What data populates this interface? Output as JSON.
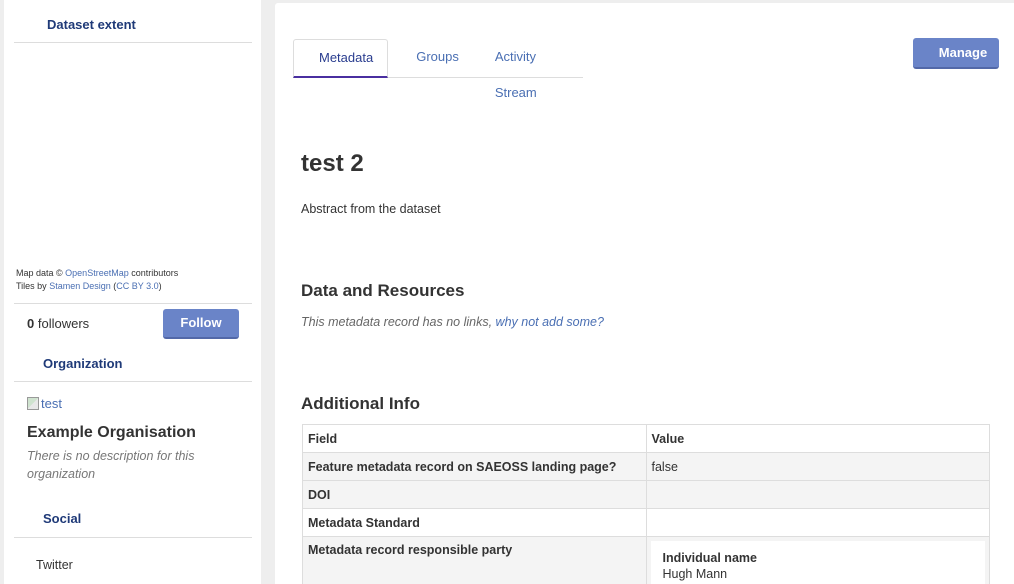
{
  "sidebar": {
    "dataset_extent_heading": "Dataset extent",
    "attribution": {
      "line1_prefix": "Map data © ",
      "line1_link": "OpenStreetMap",
      "line1_suffix": " contributors",
      "line2_prefix": "Tiles by ",
      "line2_link": "Stamen Design",
      "line2_mid": " (",
      "line2_link2": "CC BY 3.0",
      "line2_suffix": ")"
    },
    "followers_count": "0",
    "followers_label": "followers",
    "follow_button": "Follow",
    "organization_heading": "Organization",
    "org_image_alt": "test",
    "org_name": "Example Organisation",
    "org_description": "There is no description for this organization",
    "social_heading": "Social",
    "social_twitter": "Twitter"
  },
  "main": {
    "tabs": [
      {
        "label": "Metadata"
      },
      {
        "label": "Groups"
      },
      {
        "label": "Activity Stream"
      }
    ],
    "manage_button": "Manage",
    "title": "test 2",
    "abstract": "Abstract from the dataset",
    "resources_heading": "Data and Resources",
    "no_links_text": "This metadata record has no links, ",
    "no_links_link": "why not add some?",
    "additional_info_heading": "Additional Info",
    "table": {
      "headers": {
        "field": "Field",
        "value": "Value"
      },
      "rows": [
        {
          "field": "Feature metadata record on SAEOSS landing page?",
          "value": "false"
        },
        {
          "field": "DOI",
          "value": ""
        },
        {
          "field": "Metadata Standard",
          "value": ""
        },
        {
          "field": "Metadata record responsible party",
          "value": ""
        }
      ],
      "party": {
        "label": "Individual name",
        "value": "Hugh Mann"
      }
    }
  },
  "colors": {
    "accent": "#6a84c8",
    "link": "#4a6fb3",
    "heading_blue": "#1f3a78"
  }
}
